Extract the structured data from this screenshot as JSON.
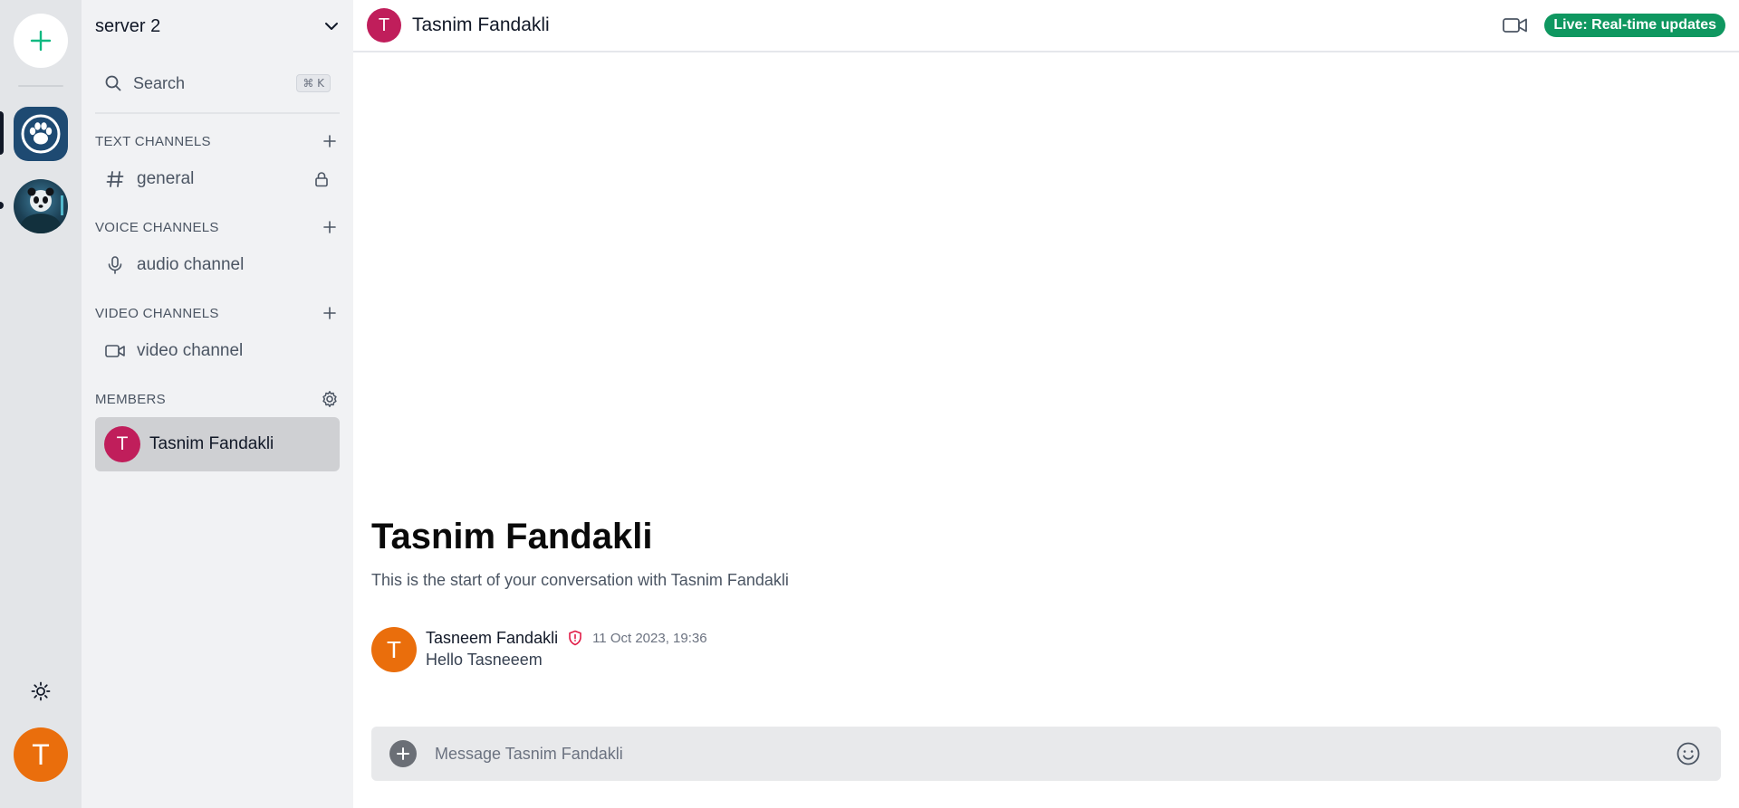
{
  "rail": {
    "add_icon": "plus-icon",
    "theme_icon": "sun-icon",
    "current_user_initial": "T",
    "current_user_color": "#ea6e0c",
    "accent": "#10b981"
  },
  "server": {
    "name": "server 2"
  },
  "search": {
    "label": "Search",
    "shortcut": "⌘ K"
  },
  "sections": {
    "text": {
      "title": "TEXT CHANNELS"
    },
    "voice": {
      "title": "VOICE CHANNELS"
    },
    "video": {
      "title": "VIDEO CHANNELS"
    },
    "members": {
      "title": "MEMBERS"
    }
  },
  "channels": {
    "text": [
      {
        "name": "general",
        "icon": "hash-icon",
        "locked": true
      }
    ],
    "voice": [
      {
        "name": "audio channel",
        "icon": "mic-icon"
      }
    ],
    "video": [
      {
        "name": "video channel",
        "icon": "video-icon"
      }
    ]
  },
  "members": [
    {
      "initial": "T",
      "name": "Tasnim Fandakli",
      "color": "#c01e5b"
    }
  ],
  "conversation": {
    "header_initial": "T",
    "header_name": "Tasnim Fandakli",
    "header_color": "#c01e5b",
    "live_badge": "Live: Real-time updates",
    "live_color": "#0f9760",
    "welcome_title": "Tasnim Fandakli",
    "welcome_sub": "This is the start of your conversation with Tasnim Fandakli",
    "messages": [
      {
        "initial": "T",
        "author": "Tasneem Fandakli",
        "role_icon": "shield-alert-icon",
        "time": "11 Oct 2023, 19:36",
        "text": "Hello Tasneeem"
      }
    ]
  },
  "composer": {
    "placeholder": "Message Tasnim Fandakli",
    "value": ""
  }
}
